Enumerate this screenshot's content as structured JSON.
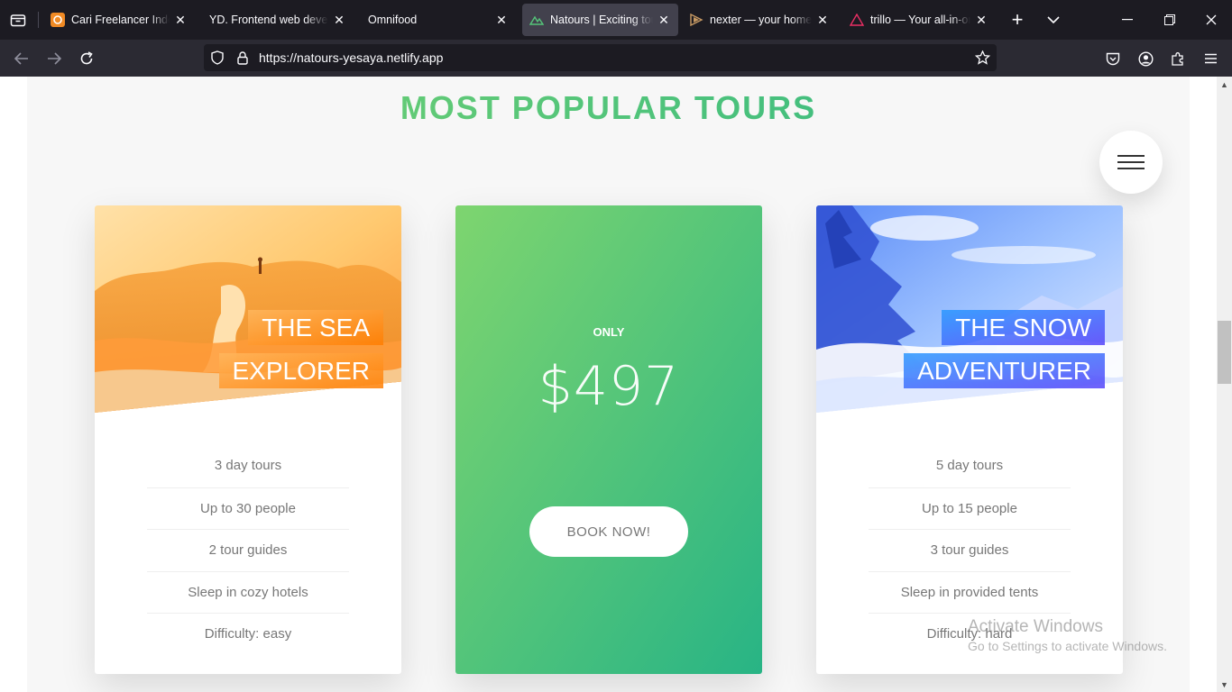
{
  "browser": {
    "tabs": [
      {
        "title": "Cari Freelancer Indonesia",
        "icon": "freelancer-favicon",
        "active": false
      },
      {
        "title": "YD. Frontend web developer",
        "icon": "none",
        "active": false
      },
      {
        "title": "Omnifood",
        "icon": "none",
        "active": false
      },
      {
        "title": "Natours | Exciting tours",
        "icon": "natours-favicon",
        "active": true
      },
      {
        "title": "nexter — your home, your freedom",
        "icon": "nexter-favicon",
        "active": false
      },
      {
        "title": "trillo — Your all-in-one booking app",
        "icon": "trillo-favicon",
        "active": false
      }
    ],
    "url": "https://natours-yesaya.netlify.app"
  },
  "page": {
    "heading": "MOST POPULAR TOURS",
    "cards": [
      {
        "heading_lines": [
          "THE SEA",
          "EXPLORER"
        ],
        "color": "#ff9a3c",
        "details": [
          "3 day tours",
          "Up to 30 people",
          "2 tour guides",
          "Sleep in cozy hotels",
          "Difficulty: easy"
        ]
      },
      {
        "only": "ONLY",
        "price": "$497",
        "button": "BOOK NOW!",
        "gradient": [
          "#7ed56f",
          "#28b485"
        ]
      },
      {
        "heading_lines": [
          "THE SNOW",
          "ADVENTURER"
        ],
        "color": "#5643fa",
        "details": [
          "5 day tours",
          "Up to 15 people",
          "3 tour guides",
          "Sleep in provided tents",
          "Difficulty: hard"
        ]
      }
    ]
  },
  "watermark": {
    "line1": "Activate Windows",
    "line2": "Go to Settings to activate Windows."
  }
}
